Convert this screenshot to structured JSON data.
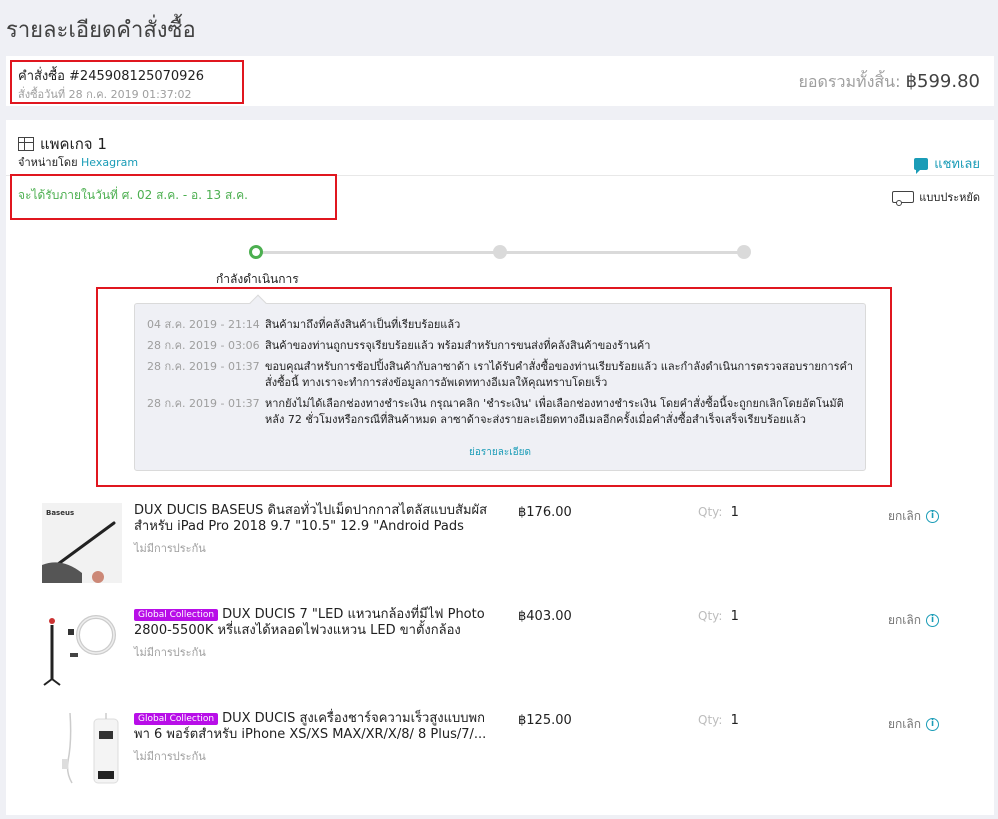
{
  "page": {
    "title": "รายละเอียดคำสั่งซื้อ"
  },
  "order": {
    "number": "คำสั่งซื้อ #245908125070926",
    "date": "สั่งซื้อวันที่ 28 ก.ค. 2019 01:37:02",
    "total_label": "ยอดรวมทั้งสิ้น:",
    "total_value": "฿599.80"
  },
  "package": {
    "title": "แพคเกจ 1",
    "sold_by_label": "จำหน่ายโดย",
    "seller": "Hexagram",
    "chat_label": "แชทเลย",
    "delivery_text": "จะได้รับภายในวันที่ ศ. 02 ส.ค. - อ. 13 ส.ค.",
    "shipping_method": "แบบประหยัด",
    "current_step": "กำลังดำเนินการ",
    "collapse_label": "ย่อรายละเอียด"
  },
  "history": [
    {
      "time": "04 ส.ค. 2019 - 21:14",
      "text": "สินค้ามาถึงที่คลังสินค้าเป็นที่เรียบร้อยแล้ว"
    },
    {
      "time": "28 ก.ค. 2019 - 03:06",
      "text": "สินค้าของท่านถูกบรรจุเรียบร้อยแล้ว พร้อมสำหรับการขนส่งที่คลังสินค้าของร้านค้า"
    },
    {
      "time": "28 ก.ค. 2019 - 01:37",
      "text": "ขอบคุณสำหรับการช้อปปิ้งสินค้ากับลาซาด้า เราได้รับคำสั่งซื้อของท่านเรียบร้อยแล้ว และกำลังดำเนินการตรวจสอบรายการคำสั่งซื้อนี้ ทางเราจะทำการส่งข้อมูลการอัพเดททางอีเมลให้คุณทราบโดยเร็ว"
    },
    {
      "time": "28 ก.ค. 2019 - 01:37",
      "text": "หากยังไม่ได้เลือกช่องทางชำระเงิน กรุณาคลิก 'ชำระเงิน' เพื่อเลือกช่องทางชำระเงิน โดยคำสั่งซื้อนี้จะถูกยกเลิกโดยอัตโนมัติหลัง 72 ชั่วโมงหรือกรณีที่สินค้าหมด ลาซาด้าจะส่งรายละเอียดทางอีเมลอีกครั้งเมื่อคำสั่งซื้อสำเร็จเสร็จเรียบร้อยแล้ว"
    }
  ],
  "items": [
    {
      "badge": "",
      "name": "DUX DUCIS BASEUS ดินสอทั่วไปเม็ดปากกาสไตลัสแบบสัมผัสสำหรับ iPad Pro 2018 9.7 \"10.5\" 12.9 \"Android Pads",
      "warranty": "ไม่มีการประกัน",
      "price": "฿176.00",
      "qty_label": "Qty:",
      "qty": "1",
      "cancel": "ยกเลิก",
      "thumb_brand": "Baseus"
    },
    {
      "badge": "Global Collection",
      "name": "DUX DUCIS 7 \"LED แหวนกล้องที่มีไฟ Photo 2800-5500K หรี่แสงได้หลอดไฟวงแหวน LED ขาตั้งกล้อง",
      "warranty": "ไม่มีการประกัน",
      "price": "฿403.00",
      "qty_label": "Qty:",
      "qty": "1",
      "cancel": "ยกเลิก"
    },
    {
      "badge": "Global Collection",
      "name": "DUX DUCIS สูงเครื่องชาร์จความเร็วสูงแบบพกพา 6 พอร์ตสำหรับ iPhone XS/XS MAX/XR/X/8/ 8 Plus/7/...",
      "warranty": "ไม่มีการประกัน",
      "price": "฿125.00",
      "qty_label": "Qty:",
      "qty": "1",
      "cancel": "ยกเลิก"
    }
  ],
  "colors": {
    "accent": "#1a9cb7",
    "success": "#4caf50",
    "badge": "#b80ee8",
    "highlight": "#e0161f"
  }
}
